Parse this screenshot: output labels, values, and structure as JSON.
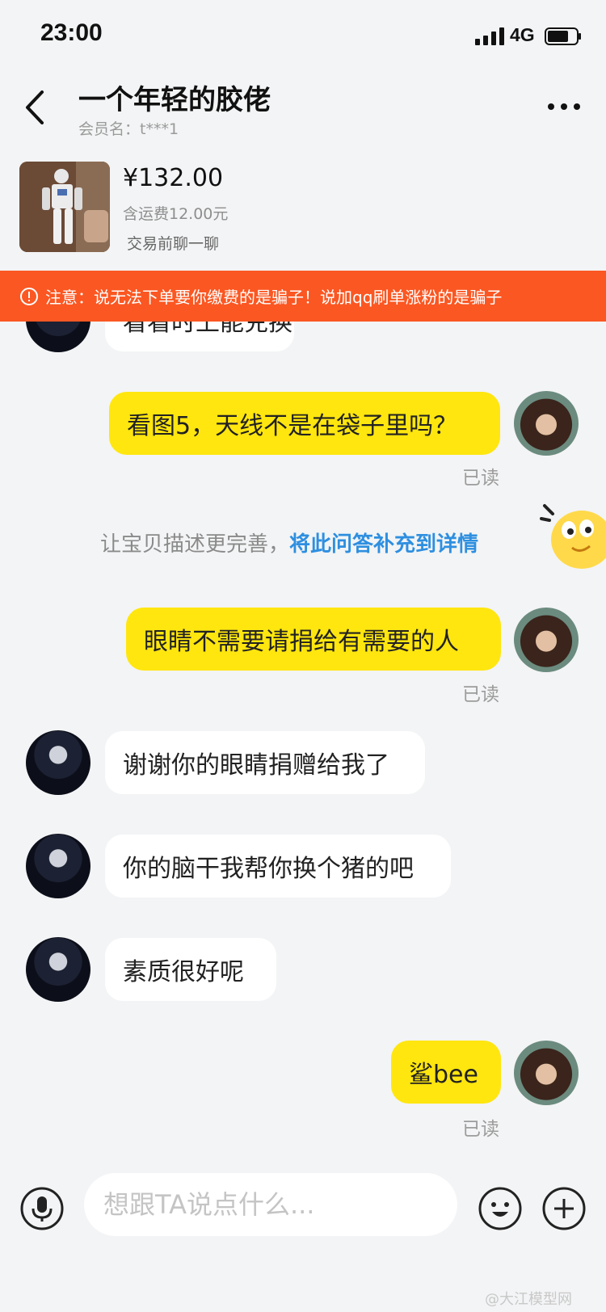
{
  "status_bar": {
    "time": "23:00",
    "network": "4G",
    "icons": [
      "signal-icon",
      "battery-icon"
    ]
  },
  "header": {
    "back_icon": "chevron-left-icon",
    "title": "一个年轻的胶佬",
    "member_label": "会员名：t***1",
    "more_icon": "more-horizontal-icon"
  },
  "product": {
    "price": "¥132.00",
    "shipping": "含运费12.00元",
    "pre_chat": "交易前聊一聊"
  },
  "warning": {
    "icon": "alert-circle-icon",
    "text": "注意：说无法下单要你缴费的是骗子！说加qq刷单涨粉的是骗子"
  },
  "messages": [
    {
      "side": "other",
      "text": "看看时上能兑换"
    },
    {
      "side": "me",
      "text": "看图5，天线不是在袋子里吗？",
      "status": "已读"
    },
    {
      "side": "me",
      "text": "眼睛不需要请捐给有需要的人",
      "status": "已读"
    },
    {
      "side": "other",
      "text": "谢谢你的眼睛捐赠给我了"
    },
    {
      "side": "other",
      "text": "你的脑干我帮你换个猪的吧"
    },
    {
      "side": "other",
      "text": "素质很好呢"
    },
    {
      "side": "me",
      "text": "鲨bee",
      "status": "已读"
    }
  ],
  "hint": {
    "text": "让宝贝描述更完善，",
    "link": "将此问答补充到详情"
  },
  "input_bar": {
    "placeholder": "想跟TA说点什么...",
    "icons": [
      "microphone-icon",
      "emoji-icon",
      "plus-icon"
    ]
  },
  "watermark": "@大江模型网"
}
